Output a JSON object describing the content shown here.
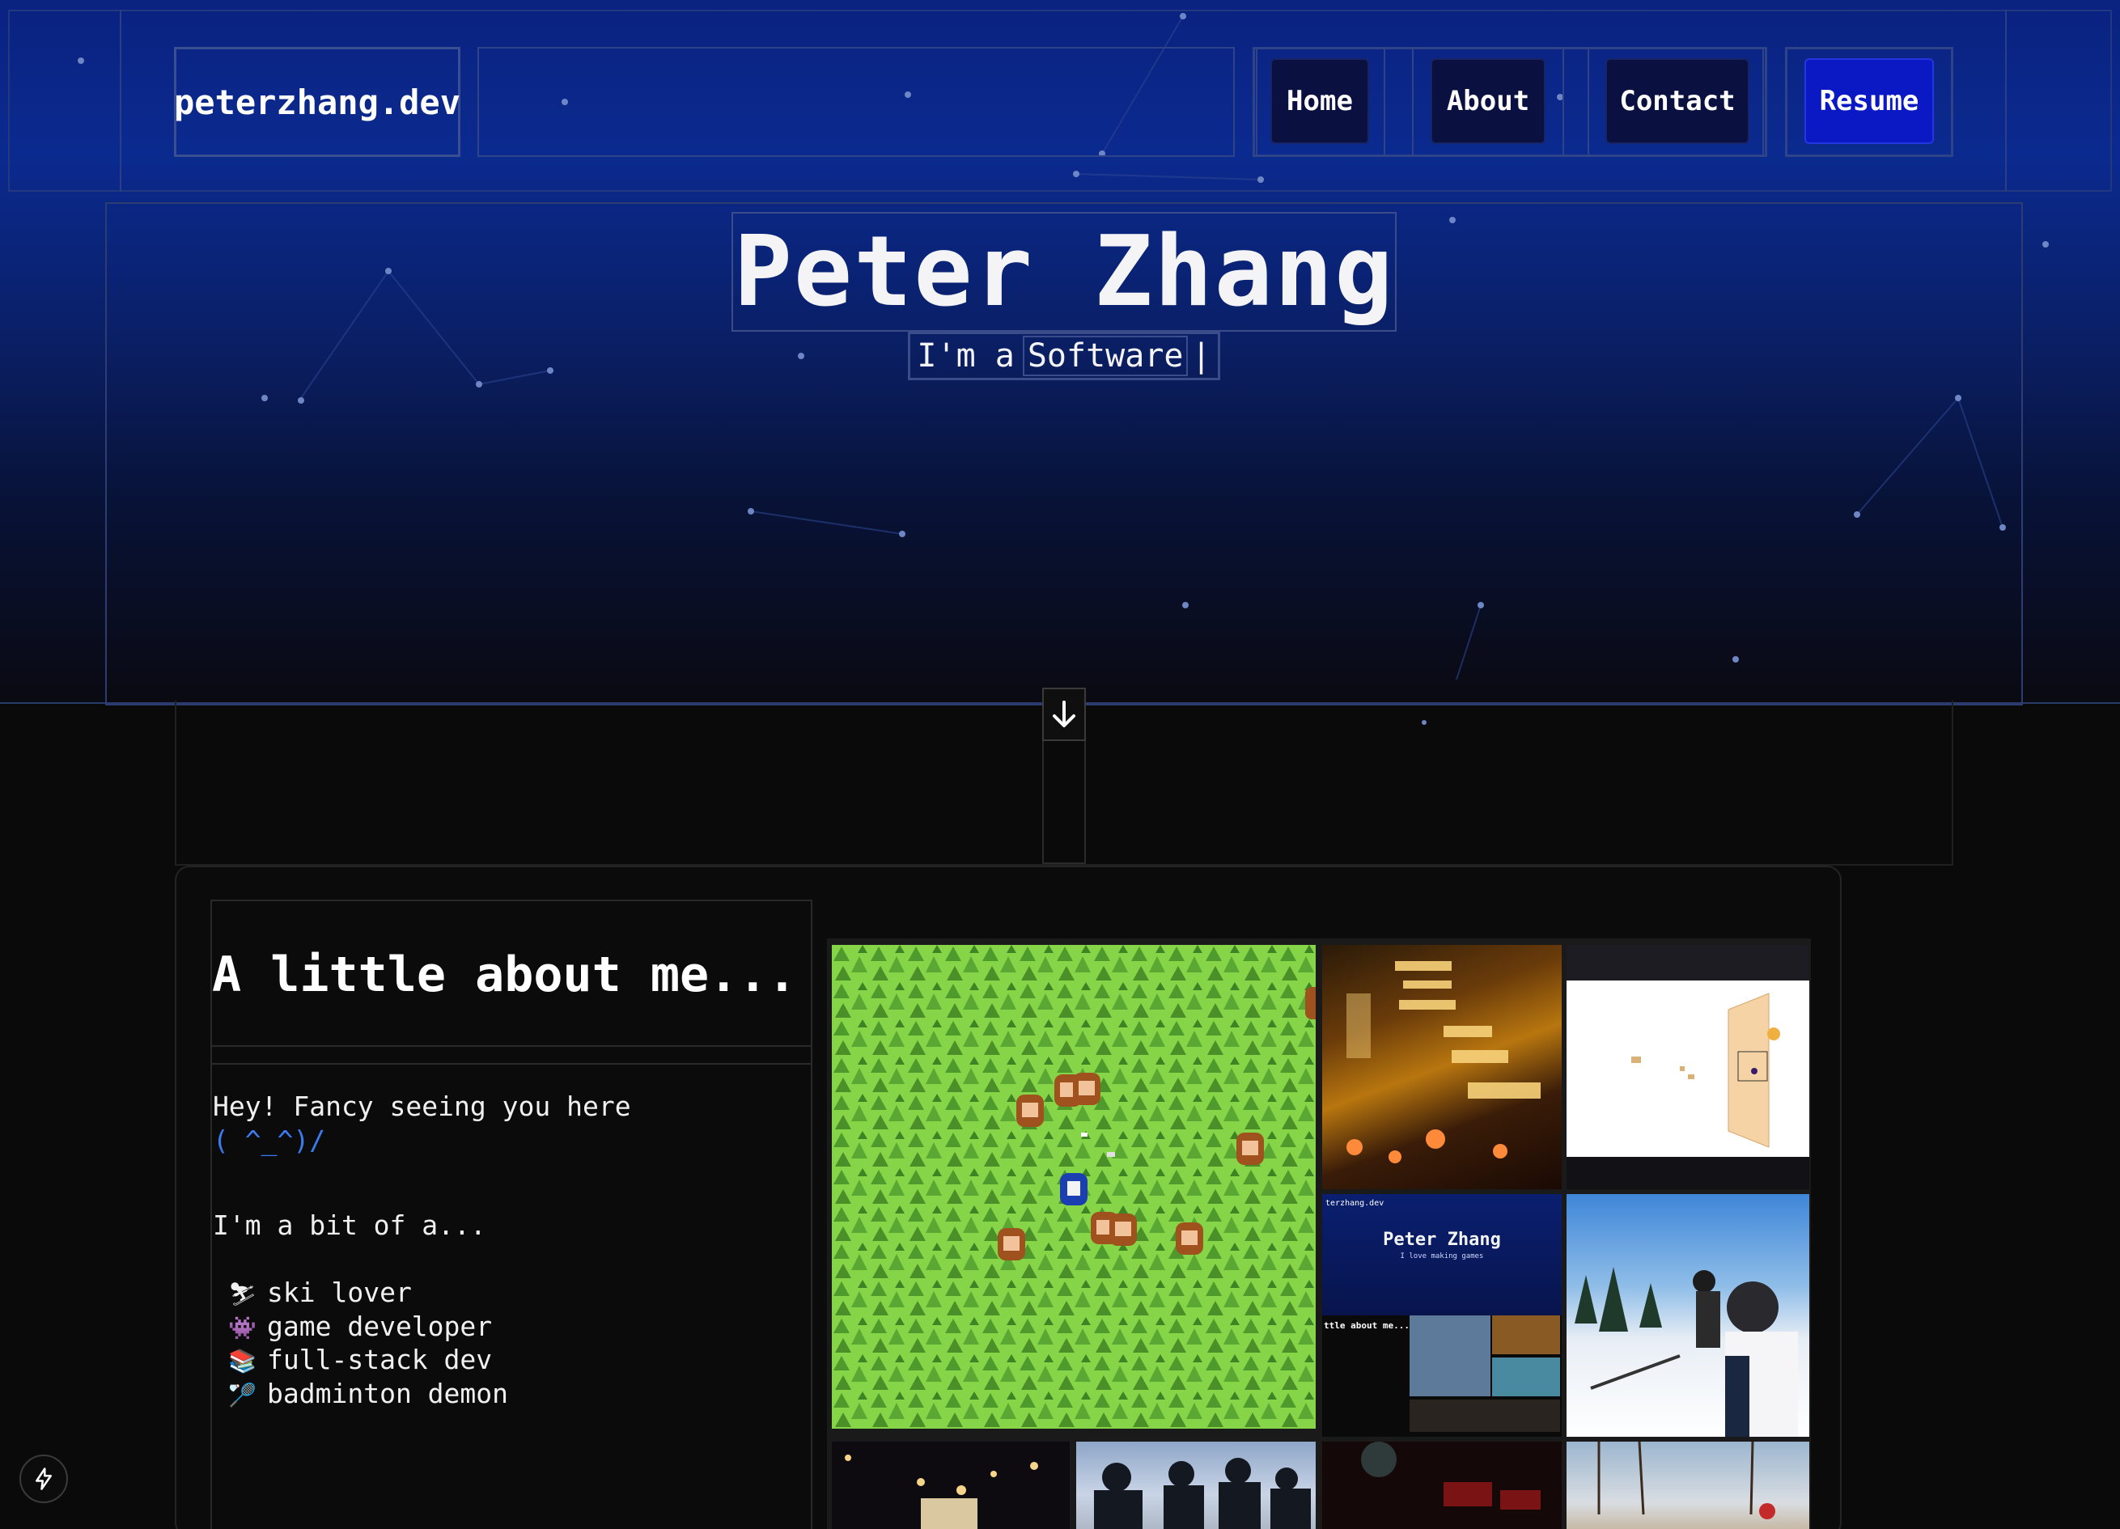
{
  "nav": {
    "brand": "peterzhang.dev",
    "links": [
      "Home",
      "About",
      "Contact"
    ],
    "resume": "Resume"
  },
  "hero": {
    "title": "Peter Zhang",
    "subtitle_prefix": "I'm a",
    "subtitle_word": "Software",
    "cursor": "|"
  },
  "about": {
    "heading": "A little about me...",
    "greeting": "Hey! Fancy seeing you here",
    "kaomoji": "( ^_^)/",
    "intro": "I'm a bit of a...",
    "traits": [
      {
        "icon": "skier-emoji",
        "glyph": "⛷",
        "label": "ski lover"
      },
      {
        "icon": "alien-monster-emoji",
        "glyph": "👾",
        "label": "game developer"
      },
      {
        "icon": "books-emoji",
        "glyph": "📚",
        "label": "full-stack dev"
      },
      {
        "icon": "badminton-emoji",
        "glyph": "🏸",
        "label": "badminton demon"
      }
    ]
  },
  "gallery": {
    "mini_site": {
      "brand": "terzhang.dev",
      "title": "Peter Zhang",
      "subtitle": "I love making games",
      "heading": "ttle about me..."
    }
  },
  "colors": {
    "accent_blue": "#0b19c4",
    "kaomoji_blue": "#3b7bf0",
    "hero_top": "#0a2280",
    "page_bg": "#0a0a0a"
  }
}
